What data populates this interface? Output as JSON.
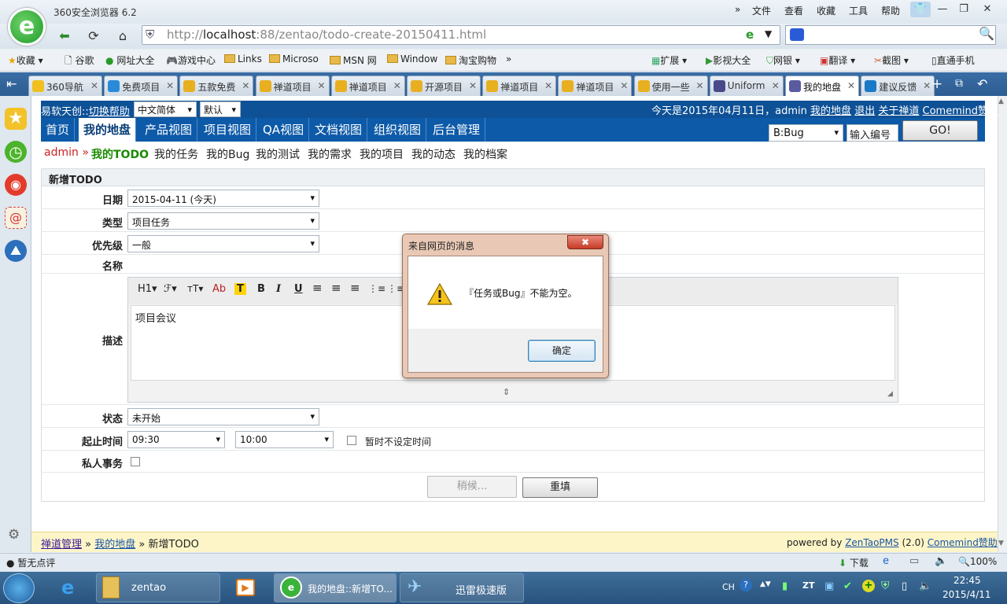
{
  "browser": {
    "title": "360安全浏览器 6.2",
    "menu": [
      "文件",
      "查看",
      "收藏",
      "工具",
      "帮助"
    ],
    "url": {
      "scheme": "http://",
      "host": "localhost",
      "rest": ":88/zentao/todo-create-20150411.html"
    },
    "bookmarks": [
      "收藏",
      "谷歌",
      "网址大全",
      "游戏中心",
      "Links",
      "Microso",
      "MSN 网",
      "Window",
      "淘宝购物"
    ],
    "bookmarks_right": [
      "扩展",
      "影视大全",
      "网银",
      "翻译",
      "截图",
      "直通手机"
    ],
    "tabs": [
      "360导航",
      "免费项目",
      "五款免费",
      "禅道项目",
      "禅道项目",
      "开源项目",
      "禅道项目",
      "禅道项目",
      "使用一些",
      "Uniform",
      "我的地盘",
      "建议反馈"
    ],
    "active_tab": 10
  },
  "zentao": {
    "header_left": "易软天创::",
    "header_link": "切换帮助",
    "lang_select": "中文简体",
    "theme_select": "默认",
    "header_right_text": "今天是2015年04月11日，admin",
    "header_links": [
      "我的地盘",
      "退出",
      "关于禅道",
      "Comemind赞助"
    ],
    "nav": [
      "首页",
      "我的地盘",
      "产品视图",
      "项目视图",
      "QA视图",
      "文档视图",
      "组织视图",
      "后台管理"
    ],
    "search_type": "B:Bug",
    "search_input": "输入编号",
    "go_button": "GO!",
    "user": "admin »",
    "subnav": [
      "我的TODO",
      "我的任务",
      "我的Bug",
      "我的测试",
      "我的需求",
      "我的项目",
      "我的动态",
      "我的档案"
    ]
  },
  "form": {
    "heading": "新增TODO",
    "date_label": "日期",
    "date_value": "2015-04-11 (今天)",
    "type_label": "类型",
    "type_value": "项目任务",
    "priority_label": "优先级",
    "priority_value": "一般",
    "name_label": "名称",
    "desc_label": "描述",
    "desc_value": "项目会议",
    "toolbar": [
      "H1▾",
      "ℱ▾",
      "тT▾",
      "Ab",
      "T",
      "B",
      "I",
      "U",
      "≡",
      "≡",
      "≡",
      "⋮≡",
      "⋮≡"
    ],
    "status_label": "状态",
    "status_value": "未开始",
    "time_label": "起止时间",
    "time_start": "09:30",
    "time_end": "10:00",
    "time_unset": "暂时不设定时间",
    "private_label": "私人事务",
    "submit_button": "稍候...",
    "reset_button": "重填"
  },
  "dialog": {
    "title": "来自网页的消息",
    "message": "『任务或Bug』不能为空。",
    "ok_button": "确定",
    "close": "✖"
  },
  "footer": {
    "breadcrumb": [
      "禅道管理",
      "我的地盘",
      "新增TODO"
    ],
    "powered_prefix": "powered by",
    "powered_link": "ZenTaoPMS",
    "version": "(2.0)",
    "sponsor": "Comemind赞助"
  },
  "statusbar": {
    "left": "暂无点评",
    "download": "下载",
    "zoom": "100%"
  },
  "taskbar": {
    "items": [
      "zentao",
      "我的地盘::新增TO...",
      "迅雷极速版"
    ],
    "ime": "CH",
    "time": "22:45",
    "date": "2015/4/11"
  },
  "colors": {
    "zentao_blue": "#0d5aa8",
    "green_text": "#1a8a00",
    "dialog_frame": "#e9c9b6"
  }
}
